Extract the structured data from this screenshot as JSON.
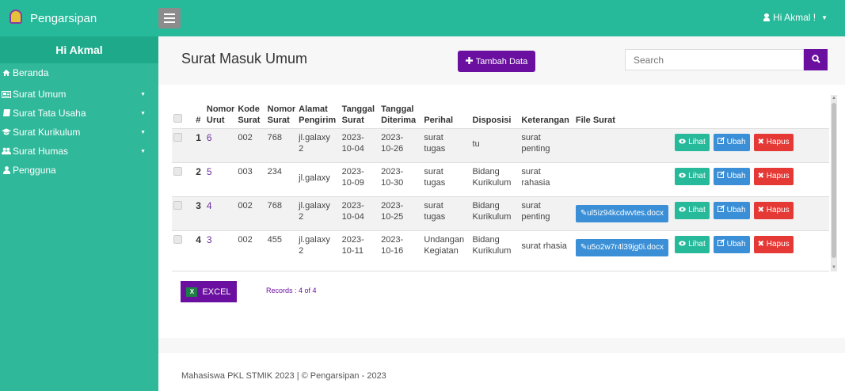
{
  "app": {
    "brand": "Pengarsipan",
    "user_menu": "Hi Akmal !"
  },
  "sidebar": {
    "greeting": "Hi Akmal",
    "items": [
      {
        "label": "Beranda",
        "icon": "home-icon"
      },
      {
        "label": "Surat Umum",
        "icon": "newspaper-icon"
      },
      {
        "label": "Surat Tata Usaha",
        "icon": "book-icon"
      },
      {
        "label": "Surat Kurikulum",
        "icon": "graduation-cap-icon"
      },
      {
        "label": "Surat Humas",
        "icon": "users-icon"
      },
      {
        "label": "Pengguna",
        "icon": "user-icon"
      }
    ]
  },
  "page": {
    "title": "Surat Masuk Umum",
    "add_button": "Tambah Data",
    "search_placeholder": "Search"
  },
  "table": {
    "headers": {
      "hash": "#",
      "nomor_urut": [
        "Nomor",
        "Urut"
      ],
      "kode_surat": [
        "Kode",
        "Surat"
      ],
      "nomor_surat": [
        "Nomor",
        "Surat"
      ],
      "alamat_pengirim": [
        "Alamat",
        "Pengirim"
      ],
      "tanggal_surat": [
        "Tanggal",
        "Surat"
      ],
      "tanggal_diterima": [
        "Tanggal",
        "Diterima"
      ],
      "perihal": "Perihal",
      "disposisi": "Disposisi",
      "keterangan": "Keterangan",
      "file_surat": "File Surat"
    },
    "rows": [
      {
        "no": "1",
        "nomor_urut": "6",
        "kode": "002",
        "nomor": "768",
        "alamat": [
          "jl.galaxy",
          "2"
        ],
        "tgl_surat": [
          "2023-",
          "10-04"
        ],
        "tgl_terima": [
          "2023-",
          "10-26"
        ],
        "perihal": [
          "surat",
          "tugas"
        ],
        "disposisi": [
          "tu",
          ""
        ],
        "keterangan": [
          "surat",
          "penting"
        ],
        "file": ""
      },
      {
        "no": "2",
        "nomor_urut": "5",
        "kode": "003",
        "nomor": "234",
        "alamat": [
          "jl.galaxy",
          ""
        ],
        "tgl_surat": [
          "2023-",
          "10-09"
        ],
        "tgl_terima": [
          "2023-",
          "10-30"
        ],
        "perihal": [
          "surat",
          "tugas"
        ],
        "disposisi": [
          "Bidang",
          "Kurikulum"
        ],
        "keterangan": [
          "surat",
          "rahasia"
        ],
        "file": ""
      },
      {
        "no": "3",
        "nomor_urut": "4",
        "kode": "002",
        "nomor": "768",
        "alamat": [
          "jl.galaxy",
          "2"
        ],
        "tgl_surat": [
          "2023-",
          "10-04"
        ],
        "tgl_terima": [
          "2023-",
          "10-25"
        ],
        "perihal": [
          "surat",
          "tugas"
        ],
        "disposisi": [
          "Bidang",
          "Kurikulum"
        ],
        "keterangan": [
          "surat",
          "penting"
        ],
        "file": "ul5iz94kcdwvtes.docx"
      },
      {
        "no": "4",
        "nomor_urut": "3",
        "kode": "002",
        "nomor": "455",
        "alamat": [
          "jl.galaxy",
          "2"
        ],
        "tgl_surat": [
          "2023-",
          "10-11"
        ],
        "tgl_terima": [
          "2023-",
          "10-16"
        ],
        "perihal": [
          "Undangan",
          "Kegiatan"
        ],
        "disposisi": [
          "Bidang",
          "Kurikulum"
        ],
        "keterangan": [
          "surat rhasia",
          ""
        ],
        "file": "u5o2w7r4l39jg0i.docx"
      }
    ],
    "actions": {
      "view": "Lihat",
      "edit": "Ubah",
      "delete": "Hapus"
    }
  },
  "export": {
    "excel_label": "EXCEL",
    "records": "Records : 4 of 4"
  },
  "footer": {
    "text": "Mahasiswa PKL STMIK 2023 | © Pengarsipan - 2023"
  },
  "colors": {
    "accent": "#26b99a",
    "brand_purple": "#6a0fa0",
    "edit_blue": "#3a8fd6",
    "delete_red": "#e53935"
  }
}
